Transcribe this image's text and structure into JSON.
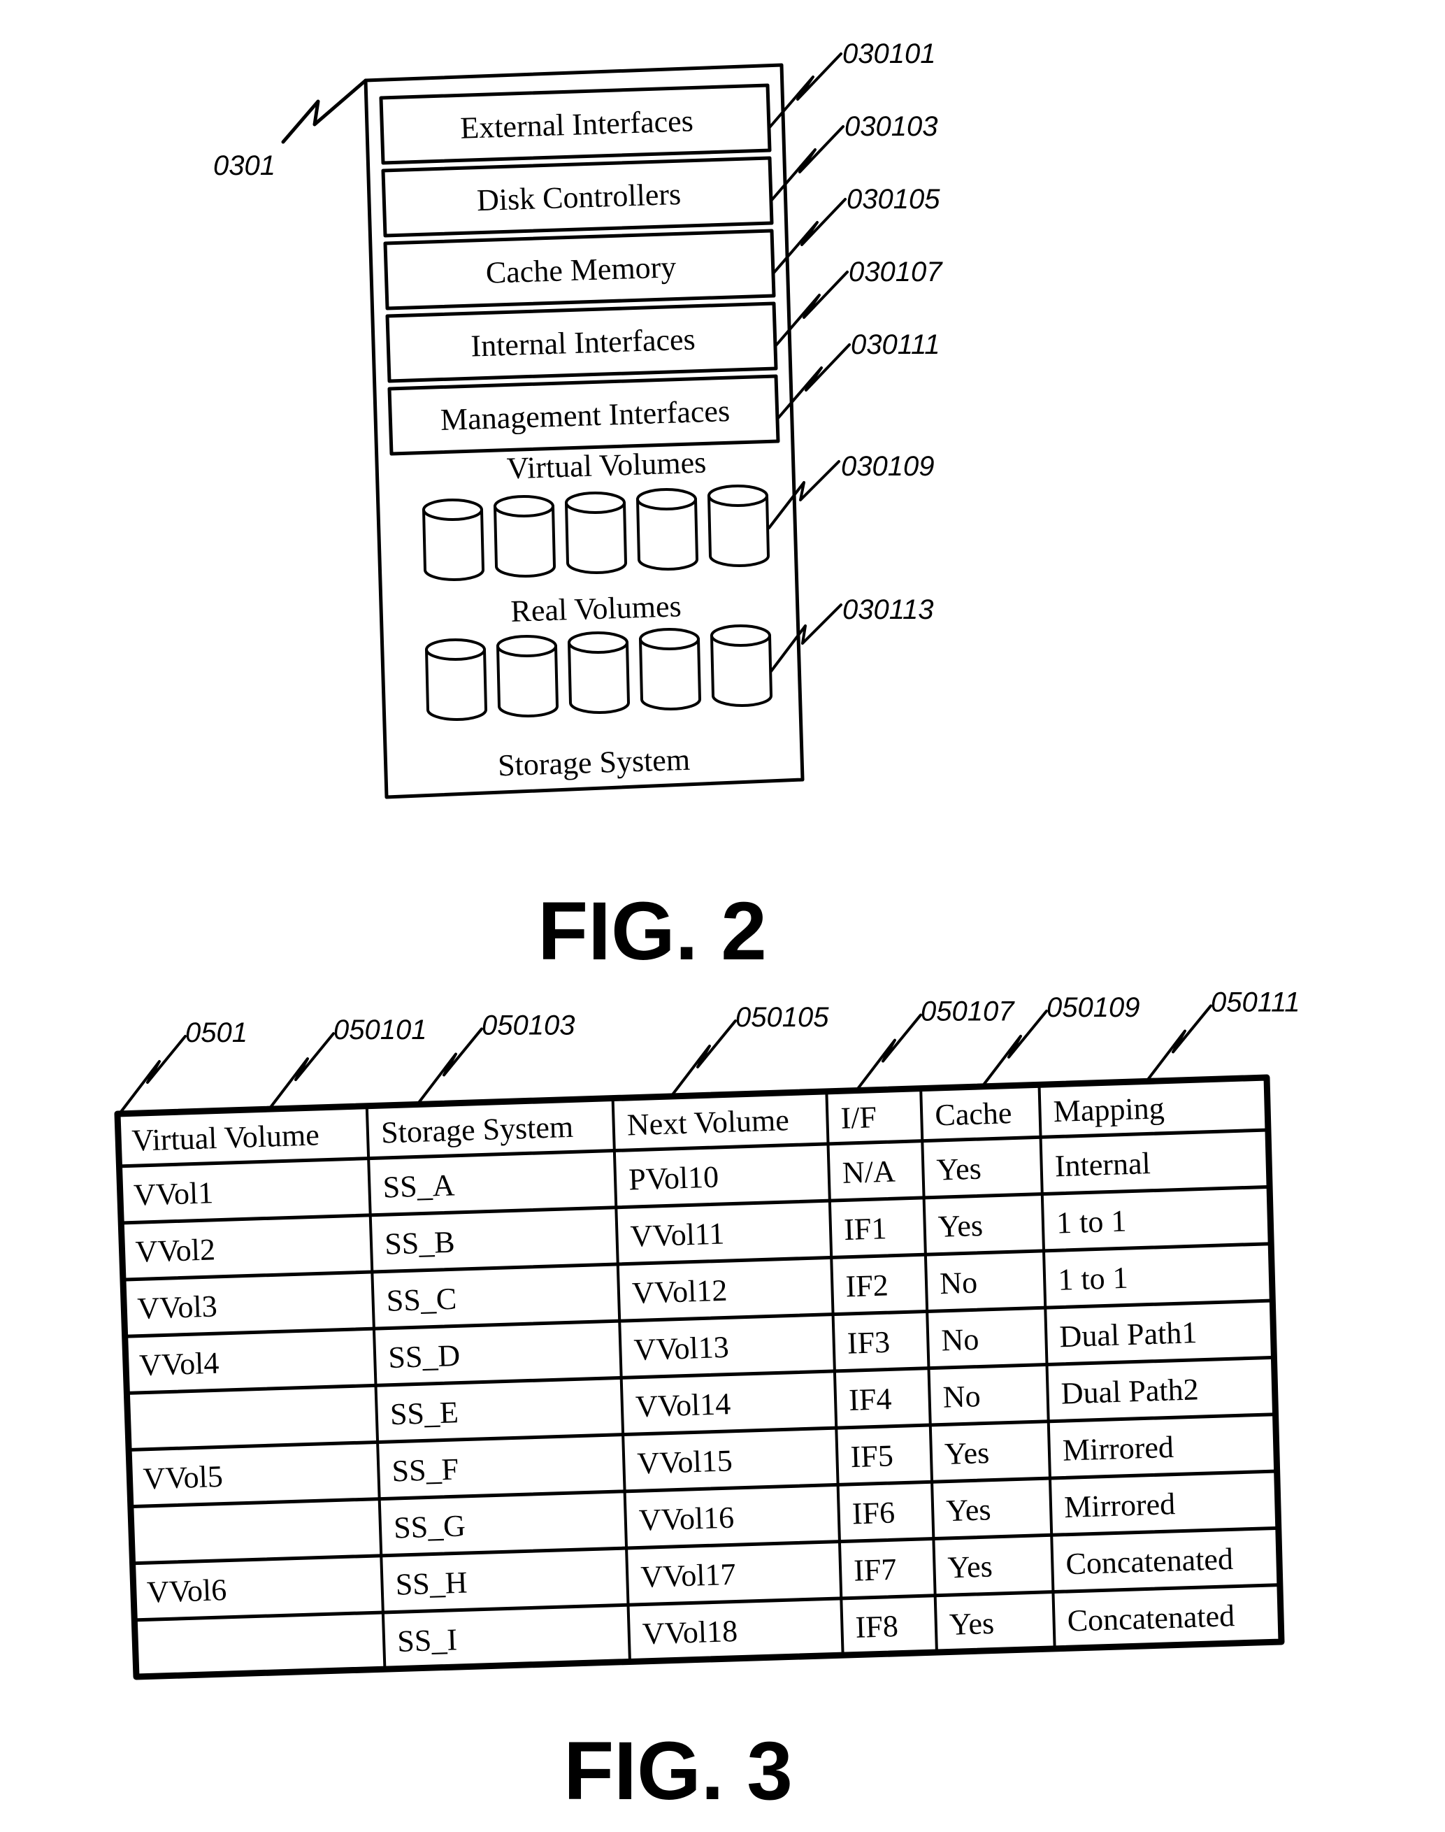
{
  "fig2": {
    "caption": "FIG. 2",
    "system_ref": "0301",
    "system_label": "Storage System",
    "components": [
      {
        "label": "External Interfaces",
        "ref": "030101"
      },
      {
        "label": "Disk Controllers",
        "ref": "030103"
      },
      {
        "label": "Cache Memory",
        "ref": "030105"
      },
      {
        "label": "Internal Interfaces",
        "ref": "030107"
      },
      {
        "label": "Management Interfaces",
        "ref": "030111"
      }
    ],
    "virtual_volumes": {
      "label": "Virtual Volumes",
      "ref": "030109",
      "count": 5
    },
    "real_volumes": {
      "label": "Real Volumes",
      "ref": "030113",
      "count": 5
    }
  },
  "fig3": {
    "caption": "FIG. 3",
    "table_ref": "0501",
    "column_refs": [
      "050101",
      "050103",
      "050105",
      "050107",
      "050109",
      "050111"
    ],
    "headers": [
      "Virtual Volume",
      "Storage System",
      "Next Volume",
      "I/F",
      "Cache",
      "Mapping"
    ],
    "rows": [
      [
        "VVol1",
        "SS_A",
        "PVol10",
        "N/A",
        "Yes",
        "Internal"
      ],
      [
        "VVol2",
        "SS_B",
        "VVol11",
        "IF1",
        "Yes",
        "1 to 1"
      ],
      [
        "VVol3",
        "SS_C",
        "VVol12",
        "IF2",
        "No",
        "1 to 1"
      ],
      [
        "VVol4",
        "SS_D",
        "VVol13",
        "IF3",
        "No",
        "Dual Path1"
      ],
      [
        "",
        "SS_E",
        "VVol14",
        "IF4",
        "No",
        "Dual Path2"
      ],
      [
        "VVol5",
        "SS_F",
        "VVol15",
        "IF5",
        "Yes",
        "Mirrored"
      ],
      [
        "",
        "SS_G",
        "VVol16",
        "IF6",
        "Yes",
        "Mirrored"
      ],
      [
        "VVol6",
        "SS_H",
        "VVol17",
        "IF7",
        "Yes",
        "Concatenated"
      ],
      [
        "",
        "SS_I",
        "VVol18",
        "IF8",
        "Yes",
        "Concatenated"
      ]
    ]
  }
}
